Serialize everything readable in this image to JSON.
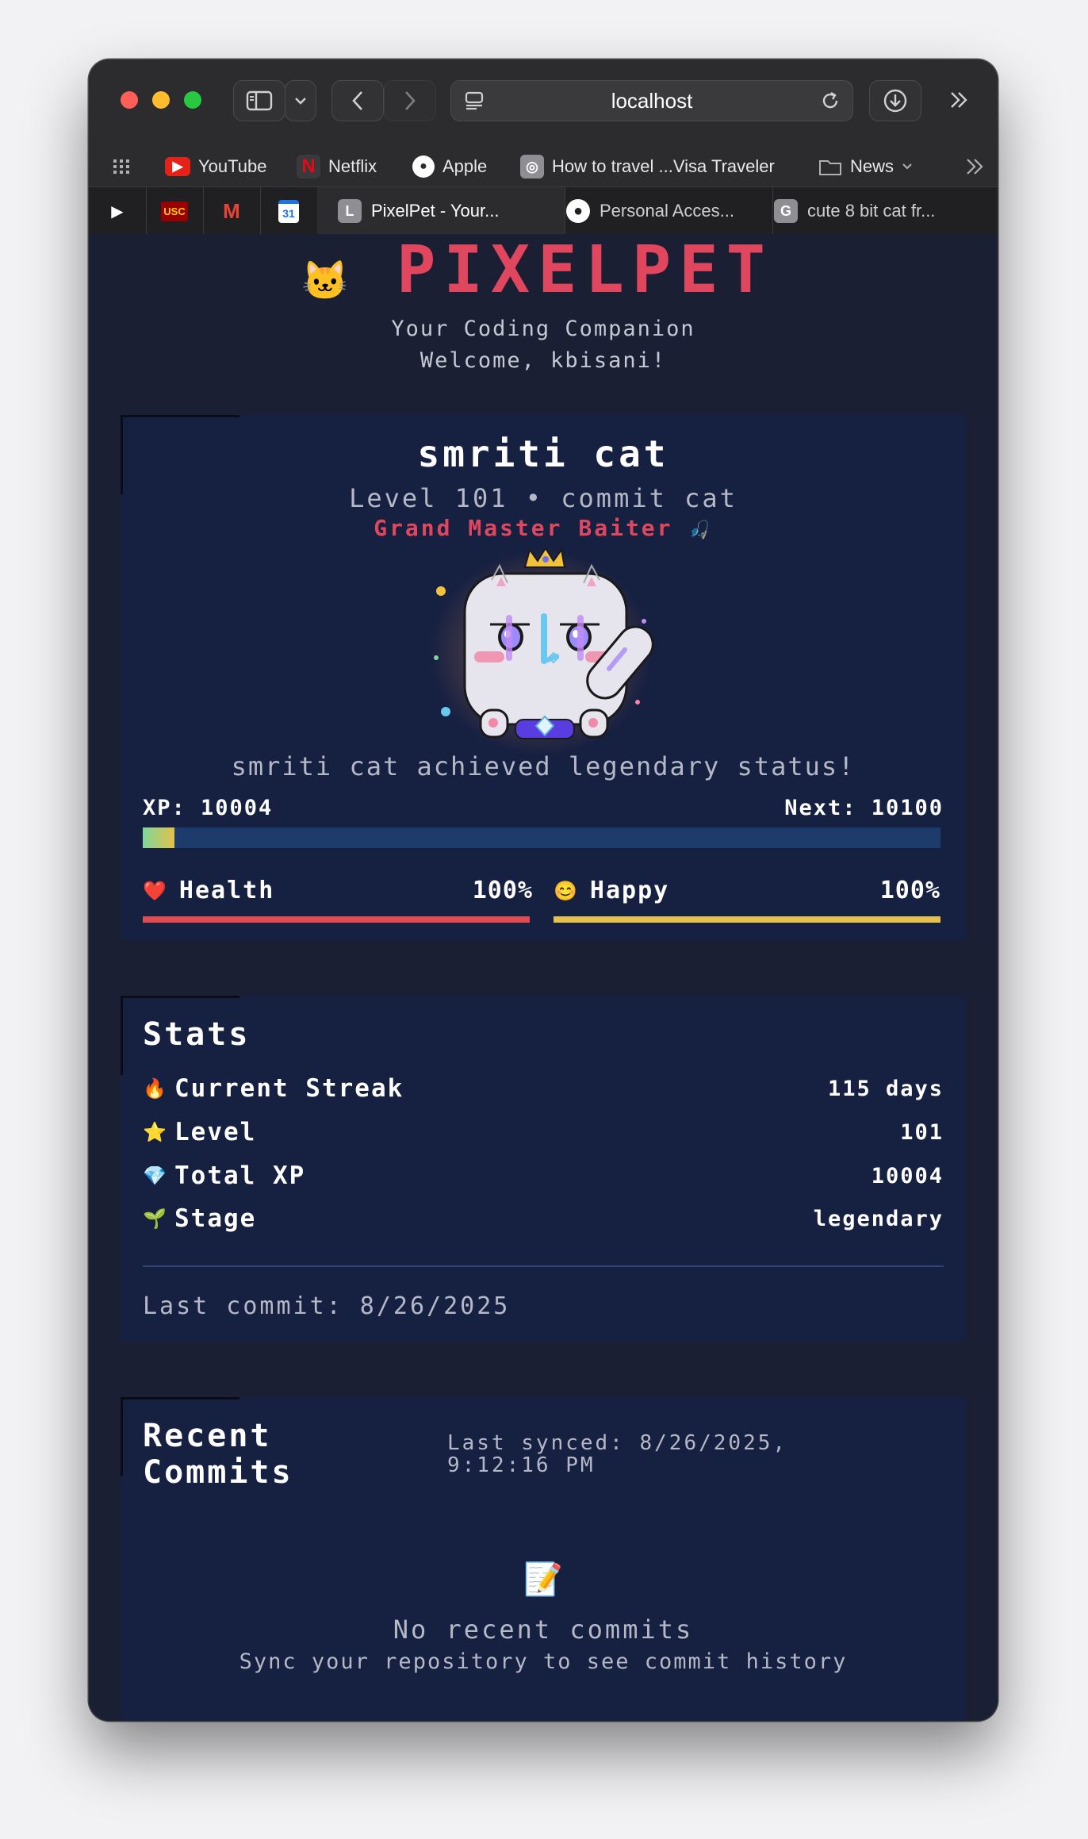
{
  "browser": {
    "url": "localhost",
    "bookmarks": [
      {
        "label": "YouTube",
        "icon": "youtube-icon",
        "color": "#e62117"
      },
      {
        "label": "Netflix",
        "icon": "netflix-icon",
        "color": "#b20710"
      },
      {
        "label": "Apple",
        "icon": "apple-icon",
        "color": "#ffffff"
      },
      {
        "label": "How to travel ...Visa Traveler",
        "icon": "globe-icon",
        "color": "#8e8e93"
      },
      {
        "label": "News",
        "icon": "folder-icon",
        "color": "#b0b0b0"
      }
    ],
    "pinned_tabs": [
      {
        "icon": "play-icon",
        "glyph": "▶"
      },
      {
        "icon": "usc-icon",
        "glyph": "USC"
      },
      {
        "icon": "gmail-icon",
        "glyph": "M"
      },
      {
        "icon": "calendar-icon",
        "glyph": "31"
      }
    ],
    "tabs": [
      {
        "label": "PixelPet - Your...",
        "icon_letter": "L",
        "active": true
      },
      {
        "label": "Personal Acces...",
        "icon_letter": "⬤",
        "active": false
      },
      {
        "label": "cute 8 bit cat fr...",
        "icon_letter": "G",
        "active": false
      }
    ]
  },
  "app": {
    "title": "PIXELPET",
    "tagline": "Your Coding Companion",
    "welcome": "Welcome, kbisani!"
  },
  "pet": {
    "name": "smriti cat",
    "level_line": "Level 101 • commit cat",
    "title": "Grand Master Baiter",
    "title_icon": "🎣",
    "achievement": "smriti cat achieved legendary status!",
    "xp_label": "XP: 10004",
    "next_label": "Next: 10100",
    "xp_progress": 0.04,
    "health_label": "Health",
    "health_value": "100%",
    "health_fraction": 1.0,
    "happy_label": "Happy",
    "happy_value": "100%",
    "happy_fraction": 1.0,
    "colors": {
      "accent": "#e0475e",
      "health": "#e24a4f",
      "happy": "#e5c04a"
    }
  },
  "stats": {
    "title": "Stats",
    "rows": [
      {
        "icon": "🔥",
        "label": "Current Streak",
        "value": "115 days"
      },
      {
        "icon": "⭐",
        "label": "Level",
        "value": "101"
      },
      {
        "icon": "💎",
        "label": "Total XP",
        "value": "10004"
      },
      {
        "icon": "🌱",
        "label": "Stage",
        "value": "legendary"
      }
    ],
    "last_commit": "Last commit: 8/26/2025"
  },
  "commits": {
    "title_line1": "Recent",
    "title_line2": "Commits",
    "synced_line1": "Last synced: 8/26/2025,",
    "synced_line2": "9:12:16 PM",
    "empty_icon": "📝",
    "empty_title": "No recent commits",
    "empty_sub": "Sync your repository to see commit history"
  }
}
